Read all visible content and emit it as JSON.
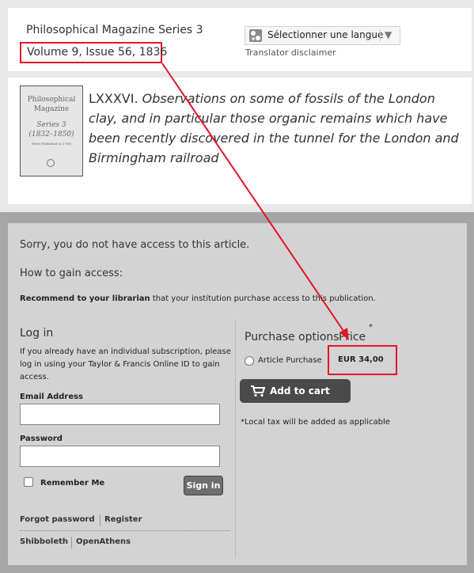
{
  "header": {
    "series_title": "Philosophical Magazine Series 3",
    "volume_issue": "Volume 9, Issue 56, 1836",
    "language_select": "Sélectionner une langue",
    "translator_disclaimer": "Translator disclaimer"
  },
  "article": {
    "cover": {
      "title_line1": "Philosophical",
      "title_line2": "Magazine",
      "series_line": "Series 3",
      "years_line": "(1832–1850)",
      "subtitle": "(First Published in 1798)"
    },
    "number": "LXXXVI.",
    "title": "Observations on some of fossils of the London clay, and in particular those organic remains which have been recently discovered in the tunnel for the London and Birmingham railroad"
  },
  "access": {
    "sorry_text": "Sorry, you do not have access to this article.",
    "how_to_heading": "How to gain access:",
    "recommend_bold": "Recommend to your librarian",
    "recommend_rest": " that your institution purchase access to this publication.",
    "login": {
      "heading": "Log in",
      "help_text": "If you already have an individual subscription, please log in using your Taylor & Francis Online ID to gain access.",
      "email_label": "Email Address",
      "email_value": "",
      "password_label": "Password",
      "password_value": "",
      "remember_label": "Remember Me",
      "signin_label": "Sign in",
      "forgot_label": "Forgot password",
      "register_label": "Register",
      "shibboleth_label": "Shibboleth",
      "openathens_label": "OpenAthens"
    },
    "purchase": {
      "heading": "Purchase options",
      "price_heading": "Price",
      "price_star": "*",
      "option_label": "Article Purchase",
      "price_value": "EUR 34,00",
      "cart_label": "Add to cart",
      "tax_note": "*Local tax will be added as applicable"
    }
  },
  "colors": {
    "annotation_red": "#e3142b",
    "panel_grey": "#d3d3d3",
    "frame_grey": "#a6a6a6"
  }
}
